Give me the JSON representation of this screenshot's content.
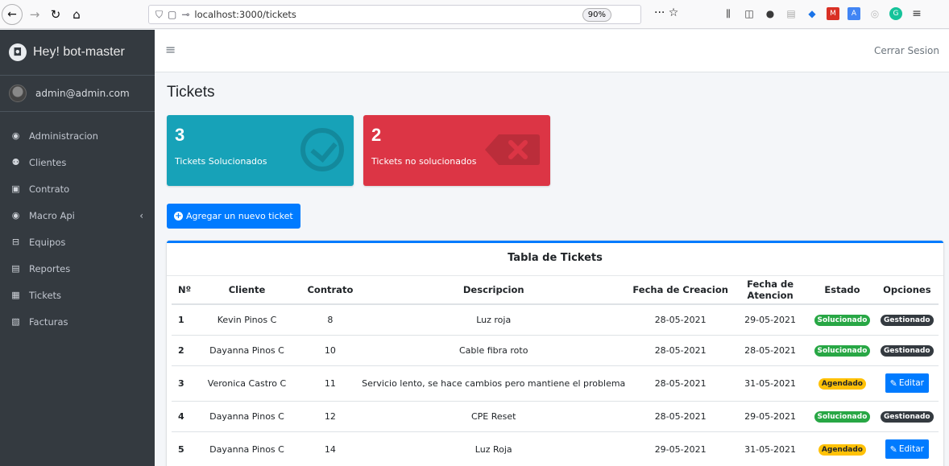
{
  "browser": {
    "url": "localhost:3000/tickets",
    "zoom": "90%",
    "actions": "··· ☆"
  },
  "sidebar": {
    "brand": "Hey! bot-master",
    "user": "admin@admin.com",
    "items": [
      {
        "label": "Administracion",
        "icon": "dashboard-icon"
      },
      {
        "label": "Clientes",
        "icon": "users-icon"
      },
      {
        "label": "Contrato",
        "icon": "id-card-icon"
      },
      {
        "label": "Macro Api",
        "icon": "dashboard-icon"
      },
      {
        "label": "Equipos",
        "icon": "hdd-icon"
      },
      {
        "label": "Reportes",
        "icon": "file-icon"
      },
      {
        "label": "Tickets",
        "icon": "clipboard-icon"
      },
      {
        "label": "Facturas",
        "icon": "invoice-icon"
      }
    ]
  },
  "navbar": {
    "logout": "Cerrar Sesion"
  },
  "main": {
    "title": "Tickets",
    "solved": {
      "count": "3",
      "label": "Tickets Solucionados",
      "color": "#17a2b8"
    },
    "unsolved": {
      "count": "2",
      "label": "Tickets no solucionados",
      "color": "#dc3545"
    },
    "add_button": "Agregar un nuevo ticket"
  },
  "table": {
    "title": "Tabla de Tickets",
    "headers": [
      "Nº",
      "Cliente",
      "Contrato",
      "Descripcion",
      "Fecha de Creacion",
      "Fecha de Atencion",
      "Estado",
      "Opciones"
    ],
    "rows": [
      {
        "num": "1",
        "cliente": "Kevin Pinos C",
        "contrato": "8",
        "descripcion": "Luz roja",
        "creacion": "28-05-2021",
        "atencion": "29-05-2021",
        "estado": "Solucionado",
        "opcion": "Gestionado"
      },
      {
        "num": "2",
        "cliente": "Dayanna Pinos C",
        "contrato": "10",
        "descripcion": "Cable fibra roto",
        "creacion": "28-05-2021",
        "atencion": "28-05-2021",
        "estado": "Solucionado",
        "opcion": "Gestionado"
      },
      {
        "num": "3",
        "cliente": "Veronica Castro C",
        "contrato": "11",
        "descripcion": "Servicio lento, se hace cambios pero mantiene el problema",
        "creacion": "28-05-2021",
        "atencion": "31-05-2021",
        "estado": "Agendado",
        "opcion": "Editar"
      },
      {
        "num": "4",
        "cliente": "Dayanna Pinos C",
        "contrato": "12",
        "descripcion": "CPE Reset",
        "creacion": "28-05-2021",
        "atencion": "29-05-2021",
        "estado": "Solucionado",
        "opcion": "Gestionado"
      },
      {
        "num": "5",
        "cliente": "Dayanna Pinos C",
        "contrato": "14",
        "descripcion": "Luz Roja",
        "creacion": "29-05-2021",
        "atencion": "31-05-2021",
        "estado": "Agendado",
        "opcion": "Editar"
      }
    ]
  }
}
